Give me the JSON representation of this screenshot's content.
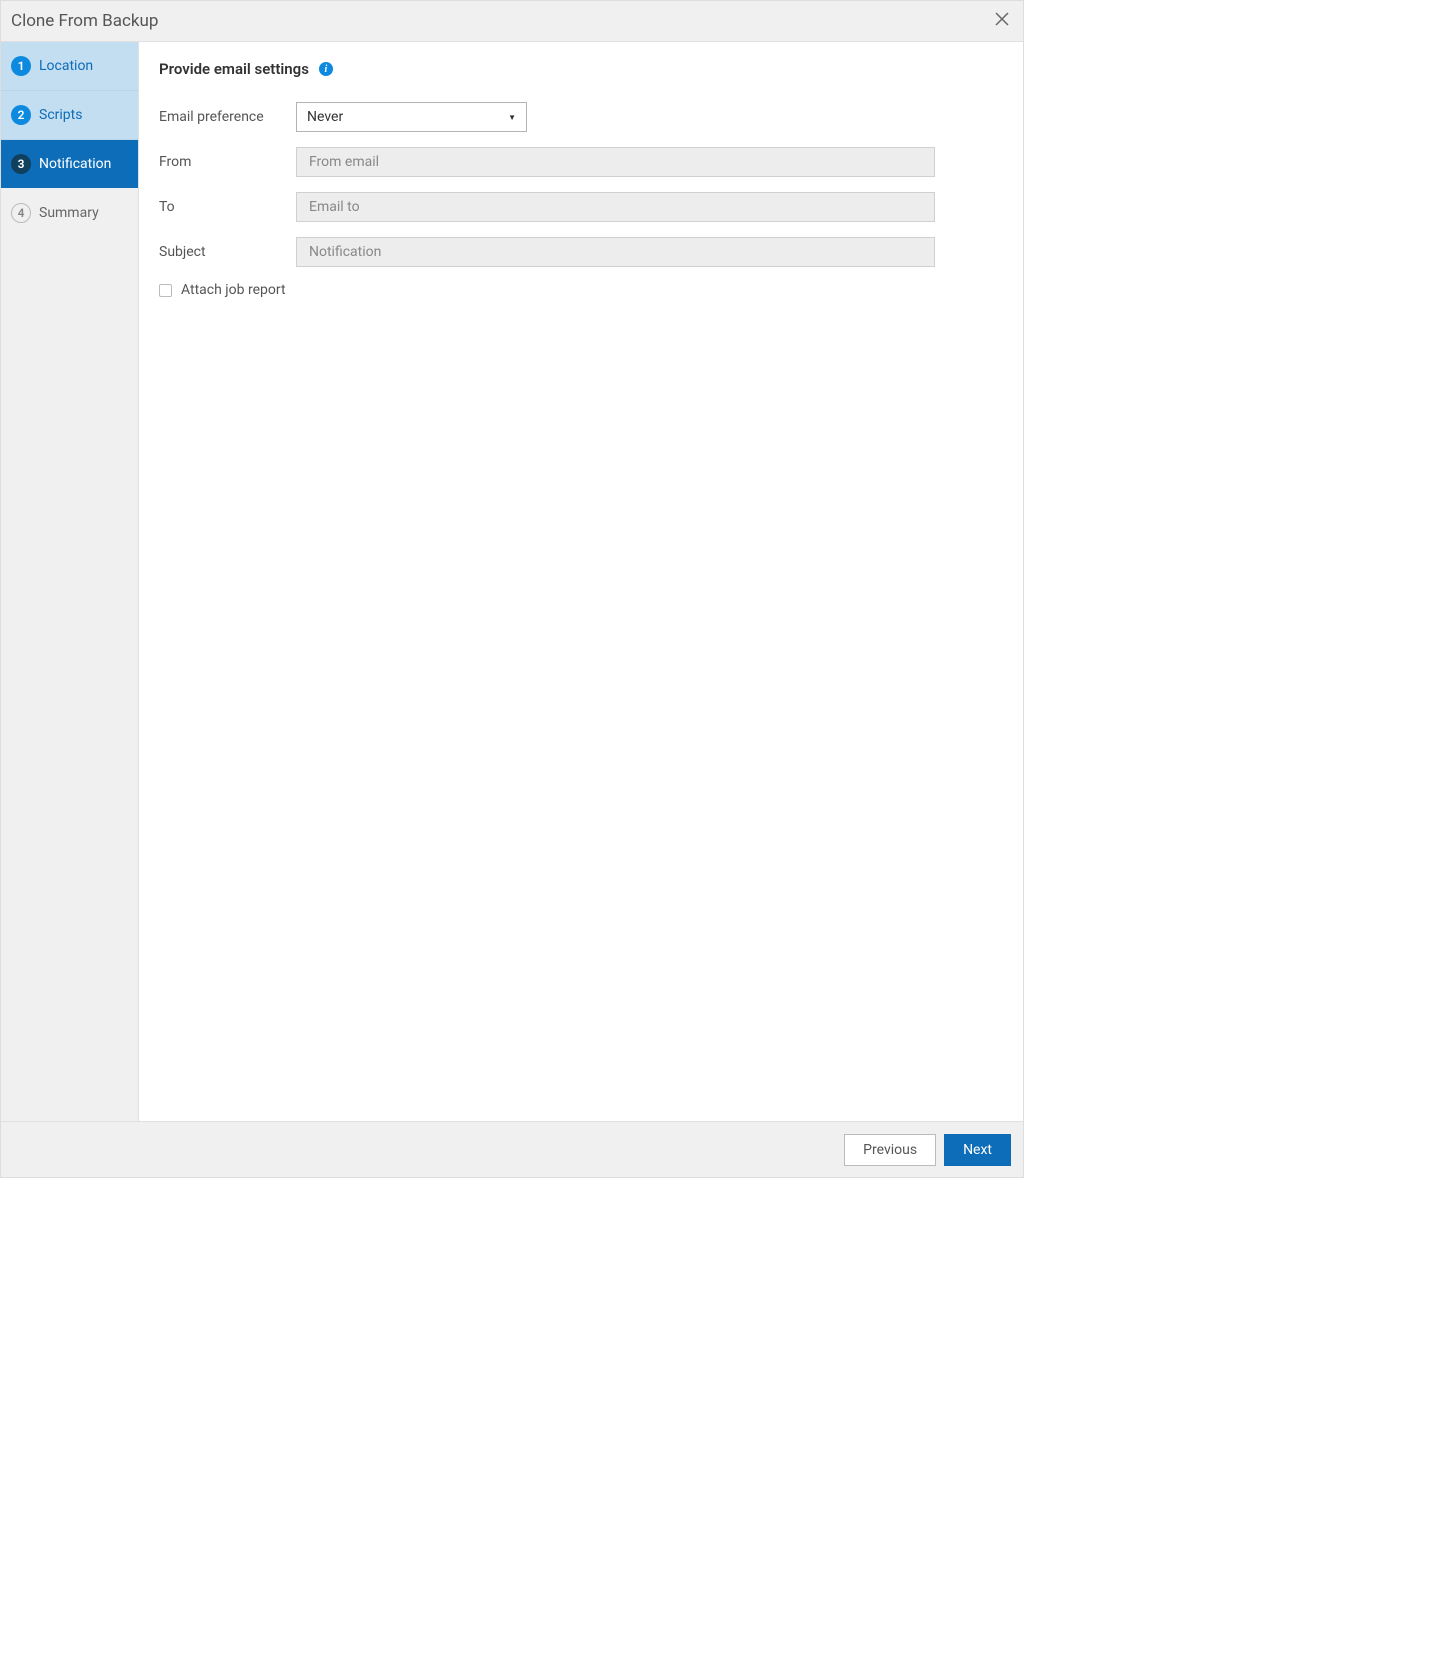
{
  "header": {
    "title": "Clone From Backup"
  },
  "wizard": {
    "steps": [
      {
        "number": "1",
        "label": "Location",
        "state": "completed"
      },
      {
        "number": "2",
        "label": "Scripts",
        "state": "completed"
      },
      {
        "number": "3",
        "label": "Notification",
        "state": "current"
      },
      {
        "number": "4",
        "label": "Summary",
        "state": "pending"
      }
    ]
  },
  "content": {
    "title": "Provide email settings",
    "labels": {
      "emailPreference": "Email preference",
      "from": "From",
      "to": "To",
      "subject": "Subject",
      "attachJobReport": "Attach job report"
    },
    "fields": {
      "emailPreference": {
        "value": "Never"
      },
      "from": {
        "placeholder": "From email",
        "value": ""
      },
      "to": {
        "placeholder": "Email to",
        "value": ""
      },
      "subject": {
        "placeholder": "Notification",
        "value": ""
      },
      "attachJobReport": false
    }
  },
  "footer": {
    "previous": "Previous",
    "next": "Next"
  }
}
